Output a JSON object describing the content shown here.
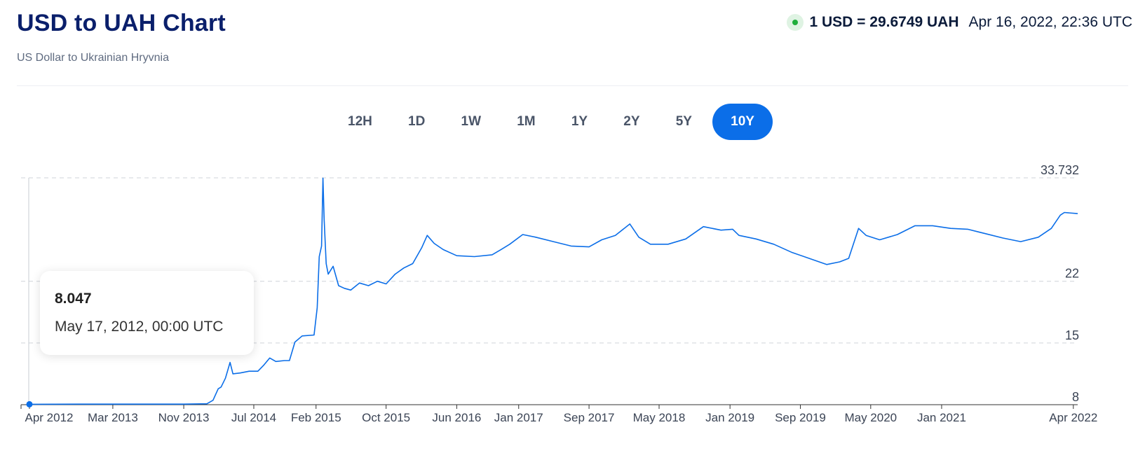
{
  "header": {
    "title": "USD to UAH Chart",
    "subtitle": "US Dollar to Ukrainian Hryvnia",
    "rate_text": "1 USD = 29.6749 UAH",
    "rate_time": "Apr 16, 2022, 22:36 UTC",
    "live_color": "#1fae3b"
  },
  "ranges": {
    "items": [
      "12H",
      "1D",
      "1W",
      "1M",
      "1Y",
      "2Y",
      "5Y",
      "10Y"
    ],
    "active": "10Y",
    "active_color": "#0b6ee8"
  },
  "tooltip": {
    "value": "8.047",
    "date": "May 17, 2012, 00:00 UTC"
  },
  "chart_data": {
    "type": "line",
    "title": "USD to UAH Chart",
    "series": [
      {
        "color": "#0b6ee8",
        "points": [
          [
            "2012-05-17",
            8.05
          ],
          [
            "2012-11-01",
            8.06
          ],
          [
            "2013-06-01",
            8.06
          ],
          [
            "2013-11-01",
            8.06
          ],
          [
            "2014-01-20",
            8.1
          ],
          [
            "2014-02-10",
            8.5
          ],
          [
            "2014-02-28",
            9.8
          ],
          [
            "2014-03-10",
            10.0
          ],
          [
            "2014-03-25",
            11.0
          ],
          [
            "2014-04-10",
            12.8
          ],
          [
            "2014-04-20",
            11.5
          ],
          [
            "2014-05-15",
            11.6
          ],
          [
            "2014-06-15",
            11.8
          ],
          [
            "2014-07-15",
            11.8
          ],
          [
            "2014-08-05",
            12.5
          ],
          [
            "2014-08-25",
            13.3
          ],
          [
            "2014-09-15",
            12.9
          ],
          [
            "2014-10-15",
            13.0
          ],
          [
            "2014-11-01",
            13.0
          ],
          [
            "2014-11-20",
            15.1
          ],
          [
            "2014-12-15",
            15.8
          ],
          [
            "2015-01-25",
            15.9
          ],
          [
            "2015-02-05",
            19.0
          ],
          [
            "2015-02-12",
            24.8
          ],
          [
            "2015-02-20",
            26.0
          ],
          [
            "2015-02-25",
            33.7
          ],
          [
            "2015-03-01",
            29.0
          ],
          [
            "2015-03-08",
            24.0
          ],
          [
            "2015-03-15",
            22.8
          ],
          [
            "2015-04-01",
            23.7
          ],
          [
            "2015-04-20",
            21.5
          ],
          [
            "2015-05-10",
            21.2
          ],
          [
            "2015-06-01",
            21.0
          ],
          [
            "2015-07-01",
            21.8
          ],
          [
            "2015-08-01",
            21.5
          ],
          [
            "2015-09-01",
            22.0
          ],
          [
            "2015-10-01",
            21.7
          ],
          [
            "2015-11-01",
            22.8
          ],
          [
            "2015-12-01",
            23.5
          ],
          [
            "2016-01-01",
            24.0
          ],
          [
            "2016-02-01",
            25.8
          ],
          [
            "2016-02-20",
            27.2
          ],
          [
            "2016-03-15",
            26.3
          ],
          [
            "2016-04-15",
            25.6
          ],
          [
            "2016-06-01",
            24.9
          ],
          [
            "2016-08-01",
            24.8
          ],
          [
            "2016-10-01",
            25.0
          ],
          [
            "2016-11-01",
            25.6
          ],
          [
            "2016-12-01",
            26.2
          ],
          [
            "2017-01-15",
            27.3
          ],
          [
            "2017-03-01",
            27.0
          ],
          [
            "2017-05-01",
            26.5
          ],
          [
            "2017-07-01",
            26.0
          ],
          [
            "2017-09-01",
            25.9
          ],
          [
            "2017-10-15",
            26.7
          ],
          [
            "2017-12-01",
            27.2
          ],
          [
            "2018-01-20",
            28.5
          ],
          [
            "2018-02-20",
            27.0
          ],
          [
            "2018-04-01",
            26.2
          ],
          [
            "2018-06-01",
            26.2
          ],
          [
            "2018-08-01",
            26.8
          ],
          [
            "2018-10-01",
            28.2
          ],
          [
            "2018-12-01",
            27.8
          ],
          [
            "2019-01-10",
            27.9
          ],
          [
            "2019-02-01",
            27.2
          ],
          [
            "2019-04-01",
            26.8
          ],
          [
            "2019-06-01",
            26.2
          ],
          [
            "2019-08-01",
            25.3
          ],
          [
            "2019-10-01",
            24.6
          ],
          [
            "2019-12-01",
            23.9
          ],
          [
            "2020-01-15",
            24.2
          ],
          [
            "2020-02-15",
            24.6
          ],
          [
            "2020-03-20",
            28.0
          ],
          [
            "2020-04-15",
            27.2
          ],
          [
            "2020-06-01",
            26.7
          ],
          [
            "2020-08-01",
            27.3
          ],
          [
            "2020-10-01",
            28.3
          ],
          [
            "2020-12-01",
            28.3
          ],
          [
            "2021-02-01",
            28.0
          ],
          [
            "2021-04-01",
            27.9
          ],
          [
            "2021-06-01",
            27.4
          ],
          [
            "2021-08-01",
            26.9
          ],
          [
            "2021-10-01",
            26.5
          ],
          [
            "2021-12-01",
            27.0
          ],
          [
            "2022-01-15",
            28.0
          ],
          [
            "2022-02-15",
            29.5
          ],
          [
            "2022-03-01",
            29.8
          ],
          [
            "2022-04-16",
            29.67
          ]
        ]
      }
    ],
    "x_ticks": [
      "Apr 2012",
      "Mar 2013",
      "Nov 2013",
      "Jul 2014",
      "Feb 2015",
      "Oct 2015",
      "Jun 2016",
      "Jan 2017",
      "Sep 2017",
      "May 2018",
      "Jan 2019",
      "Sep 2019",
      "May 2020",
      "Jan 2021",
      "Apr 2022"
    ],
    "x_tick_dates": [
      "2012-04-15",
      "2013-03-01",
      "2013-11-01",
      "2014-07-01",
      "2015-02-01",
      "2015-10-01",
      "2016-06-01",
      "2017-01-01",
      "2017-09-01",
      "2018-05-01",
      "2019-01-01",
      "2019-09-01",
      "2020-05-01",
      "2021-01-01",
      "2022-04-01"
    ],
    "y_ticks": [
      "8",
      "15",
      "22",
      "33.732"
    ],
    "y_tick_values": [
      8,
      15,
      22,
      33.732
    ],
    "xlim": [
      "2012-05-17",
      "2022-04-16"
    ],
    "ylim": [
      8,
      33.732
    ],
    "grid": "dashed-horizontal",
    "highlight_point": [
      "2012-05-17",
      8.047
    ]
  }
}
